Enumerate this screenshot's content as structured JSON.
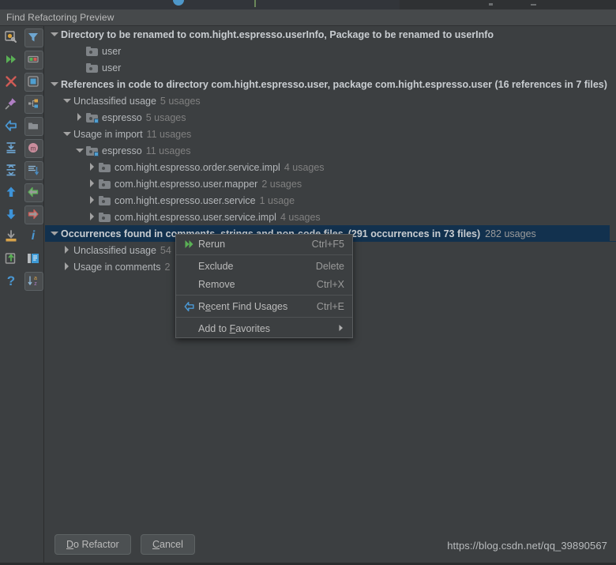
{
  "window": {
    "title": "Find Refactoring Preview"
  },
  "toolbar": {
    "left_column": [
      {
        "name": "settings-gear-icon",
        "glyph": "settings"
      },
      {
        "name": "rerun-icon",
        "glyph": "rerun"
      },
      {
        "name": "close-icon",
        "glyph": "close"
      },
      {
        "name": "pin-icon",
        "glyph": "pin"
      },
      {
        "name": "previous-occurrence-icon",
        "glyph": "back-arrow"
      },
      {
        "name": "expand-all-icon",
        "glyph": "expand"
      },
      {
        "name": "collapse-all-icon",
        "glyph": "collapse"
      },
      {
        "name": "scroll-up-icon",
        "glyph": "up"
      },
      {
        "name": "scroll-down-icon",
        "glyph": "down"
      },
      {
        "name": "export-to-file-icon",
        "glyph": "export"
      },
      {
        "name": "open-in-new-tab-icon",
        "glyph": "new-tab"
      },
      {
        "name": "help-icon",
        "glyph": "help"
      }
    ],
    "right_column": [
      {
        "name": "filter-icon",
        "glyph": "filter"
      },
      {
        "name": "show-read-write-access-icon",
        "glyph": "rw-access"
      },
      {
        "name": "group-by-module-icon",
        "glyph": "module"
      },
      {
        "name": "group-by-structure-icon",
        "glyph": "structure"
      },
      {
        "name": "group-by-directory-icon",
        "glyph": "directory"
      },
      {
        "name": "merge-usages-icon",
        "glyph": "merge"
      },
      {
        "name": "group-by-file-structure-icon",
        "glyph": "file-structure"
      },
      {
        "name": "previous-usage-icon",
        "glyph": "prev-usage"
      },
      {
        "name": "next-usage-icon",
        "glyph": "next-usage"
      },
      {
        "name": "info-icon",
        "glyph": "info"
      },
      {
        "name": "preview-usages-icon",
        "glyph": "preview"
      },
      {
        "name": "sort-alphabetically-icon",
        "glyph": "sort-az"
      }
    ]
  },
  "tree": [
    {
      "id": "directory-renamed",
      "indent": 0,
      "arrow": "down",
      "icon": "none",
      "style": "bold",
      "label": "Directory to be renamed to com.hight.espresso.userInfo, Package to be renamed to userInfo",
      "count": ""
    },
    {
      "id": "user-folder-1",
      "indent": 2,
      "arrow": "none",
      "icon": "folder",
      "style": "plain",
      "label": "user",
      "count": ""
    },
    {
      "id": "user-folder-2",
      "indent": 2,
      "arrow": "none",
      "icon": "folder",
      "style": "plain",
      "label": "user",
      "count": ""
    },
    {
      "id": "references-in-code",
      "indent": 0,
      "arrow": "down",
      "icon": "none",
      "style": "bold",
      "label": "References in code to directory com.hight.espresso.user, package com.hight.espresso.user (16 references in 7 files)",
      "count": ""
    },
    {
      "id": "unclassified-usage-1",
      "indent": 1,
      "arrow": "down",
      "icon": "none",
      "style": "plain",
      "label": "Unclassified usage",
      "count": "5 usages"
    },
    {
      "id": "espresso-1",
      "indent": 2,
      "arrow": "right",
      "icon": "folder-src",
      "style": "plain",
      "label": "espresso",
      "count": "5 usages"
    },
    {
      "id": "usage-in-import",
      "indent": 1,
      "arrow": "down",
      "icon": "none",
      "style": "plain",
      "label": "Usage in import",
      "count": "11 usages"
    },
    {
      "id": "espresso-2",
      "indent": 2,
      "arrow": "down",
      "icon": "folder-src",
      "style": "plain",
      "label": "espresso",
      "count": "11 usages"
    },
    {
      "id": "pkg-order-service-impl",
      "indent": 3,
      "arrow": "right",
      "icon": "folder",
      "style": "plain",
      "label": "com.hight.espresso.order.service.impl",
      "count": "4 usages"
    },
    {
      "id": "pkg-user-mapper",
      "indent": 3,
      "arrow": "right",
      "icon": "folder",
      "style": "plain",
      "label": "com.hight.espresso.user.mapper",
      "count": "2 usages"
    },
    {
      "id": "pkg-user-service",
      "indent": 3,
      "arrow": "right",
      "icon": "folder",
      "style": "plain",
      "label": "com.hight.espresso.user.service",
      "count": "1 usage"
    },
    {
      "id": "pkg-user-service-impl",
      "indent": 3,
      "arrow": "right",
      "icon": "folder",
      "style": "plain",
      "label": "com.hight.espresso.user.service.impl",
      "count": "4 usages"
    }
  ],
  "selected_row": {
    "id": "occurrences-found",
    "label": "Occurrences found in comments, strings and non-code files",
    "detail": "(291 occurrences in 73 files)",
    "count": "282 usages"
  },
  "tree_after_selected": [
    {
      "id": "unclassified-usage-2",
      "indent": 1,
      "arrow": "right",
      "icon": "none",
      "style": "plain",
      "label": "Unclassified usage",
      "count": "54"
    },
    {
      "id": "usage-in-comments",
      "indent": 1,
      "arrow": "right",
      "icon": "none",
      "style": "plain",
      "label": "Usage in comments",
      "count": "2"
    }
  ],
  "context_menu": {
    "items": [
      {
        "id": "rerun",
        "label": "Rerun",
        "accel": "Ctrl+F5",
        "icon": "rerun-icon",
        "mnemonic": "",
        "submenu": false
      },
      {
        "id": "separator-1",
        "type": "separator"
      },
      {
        "id": "exclude",
        "label": "Exclude",
        "accel": "Delete",
        "icon": "",
        "mnemonic": "",
        "submenu": false
      },
      {
        "id": "remove",
        "label": "Remove",
        "accel": "Ctrl+X",
        "icon": "",
        "mnemonic": "",
        "submenu": false
      },
      {
        "id": "separator-2",
        "type": "separator"
      },
      {
        "id": "recent-find-usages",
        "label": "Recent Find Usages",
        "accel": "Ctrl+E",
        "icon": "back-arrow-icon",
        "mnemonic": "e",
        "submenu": false
      },
      {
        "id": "separator-3",
        "type": "separator"
      },
      {
        "id": "add-to-favorites",
        "label": "Add to Favorites",
        "accel": "",
        "icon": "",
        "mnemonic": "F",
        "submenu": true
      }
    ]
  },
  "footer": {
    "do_refactor_label": "Do Refactor",
    "cancel_label": "Cancel",
    "watermark": "https://blog.csdn.net/qq_39890567"
  },
  "colors": {
    "background": "#3c3f41",
    "titlebar": "#46494b",
    "selection": "#12314e",
    "text": "#b4b7ba",
    "text_bold": "#c9cdd1",
    "text_muted": "#808080",
    "accent_blue": "#4f9fd1",
    "accent_green": "#62b543",
    "accent_red": "#cf5b56"
  }
}
